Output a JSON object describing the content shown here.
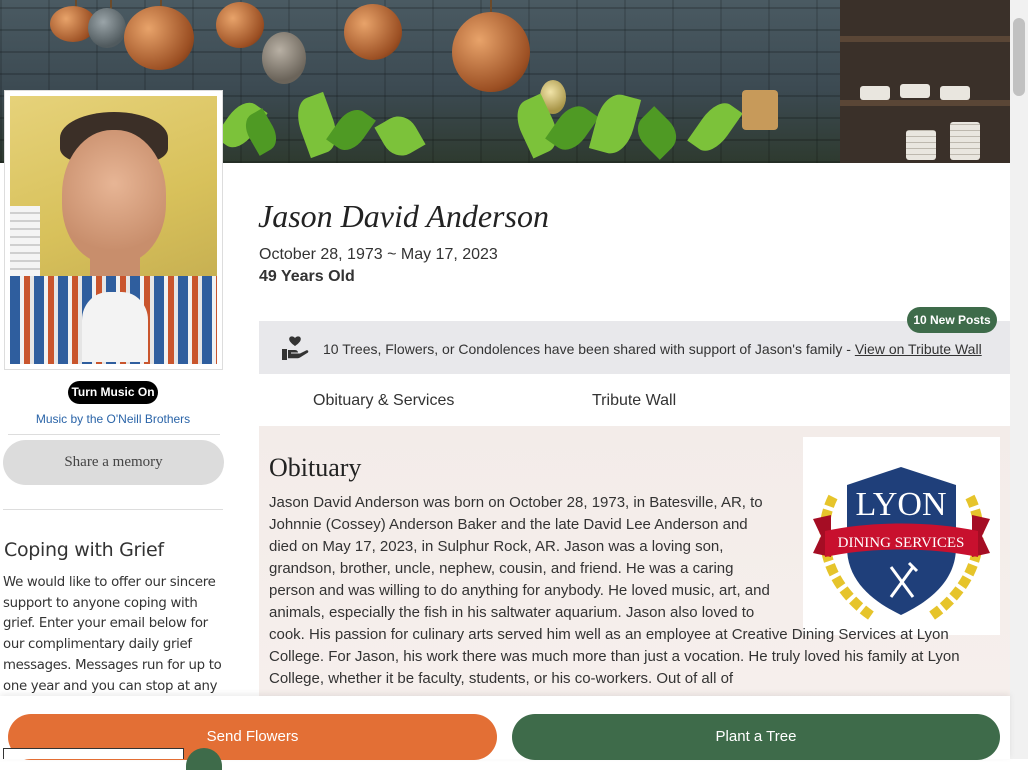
{
  "person": {
    "name": "Jason David Anderson",
    "dates": "October 28, 1973 ~ May 17, 2023",
    "age": "49 Years Old"
  },
  "music": {
    "button_label": "Turn Music On",
    "credit": "Music by the O'Neill Brothers"
  },
  "share": {
    "label": "Share a memory"
  },
  "grief": {
    "title": "Coping with Grief",
    "text": "We would like to offer our sincere support to anyone coping with grief. Enter your email below for our complimentary daily grief messages. Messages run for up to one year and you can stop at any"
  },
  "tribute_bar": {
    "badge": "10 New Posts",
    "text": "10 Trees, Flowers, or Condolences have been shared with support of Jason's family - ",
    "link": "View on Tribute Wall"
  },
  "tabs": [
    {
      "label": "Obituary & Services"
    },
    {
      "label": "Tribute Wall"
    }
  ],
  "obituary": {
    "title": "Obituary",
    "text": "Jason David Anderson was born on October 28, 1973, in Batesville, AR, to Johnnie (Cossey) Anderson Baker and the late David Lee Anderson and died on May 17, 2023, in Sulphur Rock, AR. Jason was a loving son, grandson, brother, uncle, nephew, cousin, and friend. He was a caring person and was willing to do anything for anybody. He loved music, art, and animals, especially the fish in his saltwater aquarium. Jason also loved to cook. His passion for culinary arts served him well as an employee at Creative Dining Services at Lyon College. For Jason, his work there was much more than just a vocation. He truly loved his family at Lyon College, whether it be faculty, students, or his co-workers. Out of all of",
    "logo": {
      "line1": "LYON",
      "line2": "DINING SERVICES"
    }
  },
  "footer": {
    "send_flowers": "Send Flowers",
    "plant_tree": "Plant a Tree"
  },
  "colors": {
    "accent_orange": "#e36f35",
    "accent_green": "#3e6b4a",
    "link_blue": "#2a64a8",
    "logo_navy": "#1f3f7a",
    "logo_red": "#c8102e",
    "logo_gold": "#e6c42b"
  }
}
